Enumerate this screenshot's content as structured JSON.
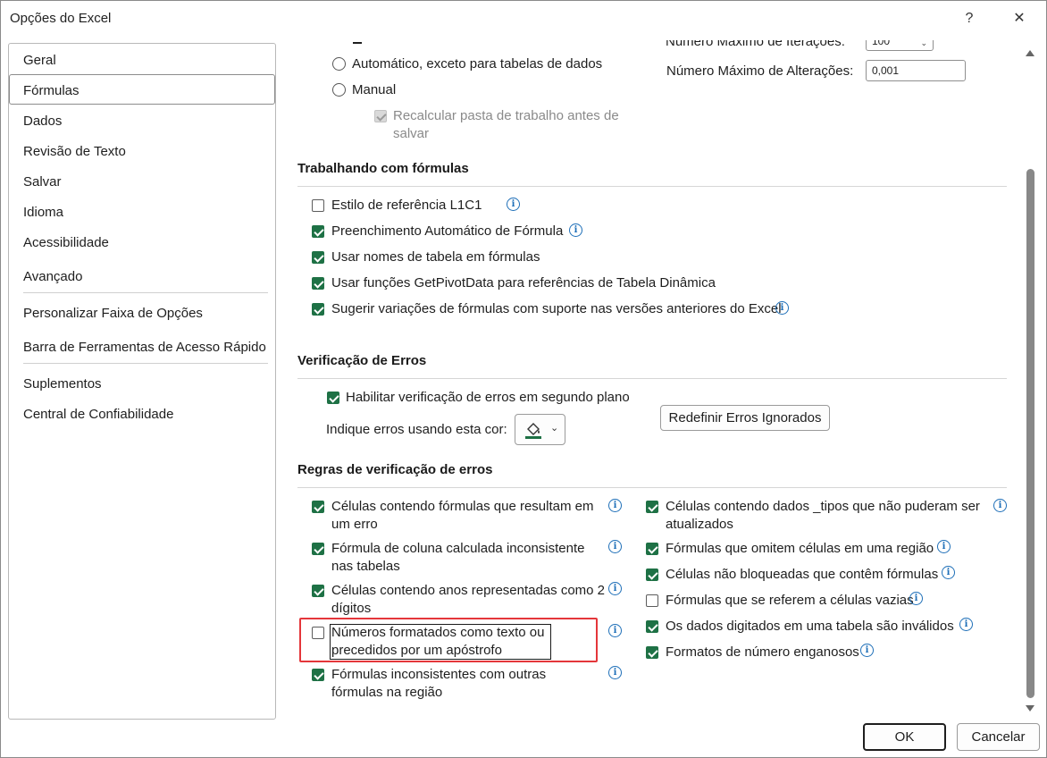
{
  "window": {
    "title": "Opções do Excel",
    "help": "?",
    "close": "✕"
  },
  "nav": {
    "items": [
      "Geral",
      "Fórmulas",
      "Dados",
      "Revisão de Texto",
      "Salvar",
      "Idioma",
      "Acessibilidade",
      "Avançado",
      "Personalizar Faixa de Opções",
      "Barra de Ferramentas de Acesso Rápido",
      "Suplementos",
      "Central de Confiabilidade"
    ],
    "selected": "Fórmulas"
  },
  "calc": {
    "opt_auto_except": "Automático, exceto para tabelas de dados",
    "opt_manual": "Manual",
    "recalc_before_save": "Recalcular pasta de trabalho antes de salvar",
    "max_iter_label": "Número Máximo de Iterações:",
    "max_iter_value": "100",
    "max_change_label": "Número Máximo de Alterações:",
    "max_change_value": "0,001"
  },
  "formulas_section": {
    "title": "Trabalhando com fórmulas",
    "items": [
      {
        "label": "Estilo de referência L1C1",
        "checked": false
      },
      {
        "label": "Preenchimento Automático de Fórmula",
        "checked": true
      },
      {
        "label": "Usar nomes de tabela em fórmulas",
        "checked": true
      },
      {
        "label": "Usar funções GetPivotData para referências de Tabela Dinâmica",
        "checked": true
      },
      {
        "label": "Sugerir variações de fórmulas com suporte nas versões anteriores do Excel",
        "checked": true
      }
    ]
  },
  "errors_section": {
    "title": "Verificação de Erros",
    "enable_bg": "Habilitar verificação de erros em segundo plano",
    "color_label": "Indique erros usando esta cor:",
    "reset_button": "Redefinir Erros Ignorados",
    "color": "#1e7145"
  },
  "rules_section": {
    "title": "Regras de verificação de erros",
    "left": [
      {
        "label": "Células contendo fórmulas que resultam em um erro",
        "checked": true
      },
      {
        "label": "Fórmula de coluna calculada inconsistente nas tabelas",
        "checked": true
      },
      {
        "label": "Células contendo anos representadas como 2 dígitos",
        "checked": true
      },
      {
        "label": "Números formatados como texto ou precedidos por um apóstrofo",
        "checked": false
      },
      {
        "label": "Fórmulas inconsistentes com outras fórmulas na região",
        "checked": true
      }
    ],
    "right": [
      {
        "label": "Células contendo dados _tipos que não puderam ser atualizados",
        "checked": true
      },
      {
        "label": "Fórmulas que omitem células em uma região",
        "checked": true
      },
      {
        "label": "Células não bloqueadas que contêm fórmulas",
        "checked": true
      },
      {
        "label": "Fórmulas que se referem a células vazias",
        "checked": false
      },
      {
        "label": "Os dados digitados em uma tabela são inválidos",
        "checked": true
      },
      {
        "label": "Formatos de número enganosos",
        "checked": true
      }
    ]
  },
  "footer": {
    "ok": "OK",
    "cancel": "Cancelar"
  },
  "colors": {
    "accent_green": "#1e7145",
    "info_blue": "#1e6fb8",
    "highlight_red": "#e4363a"
  }
}
